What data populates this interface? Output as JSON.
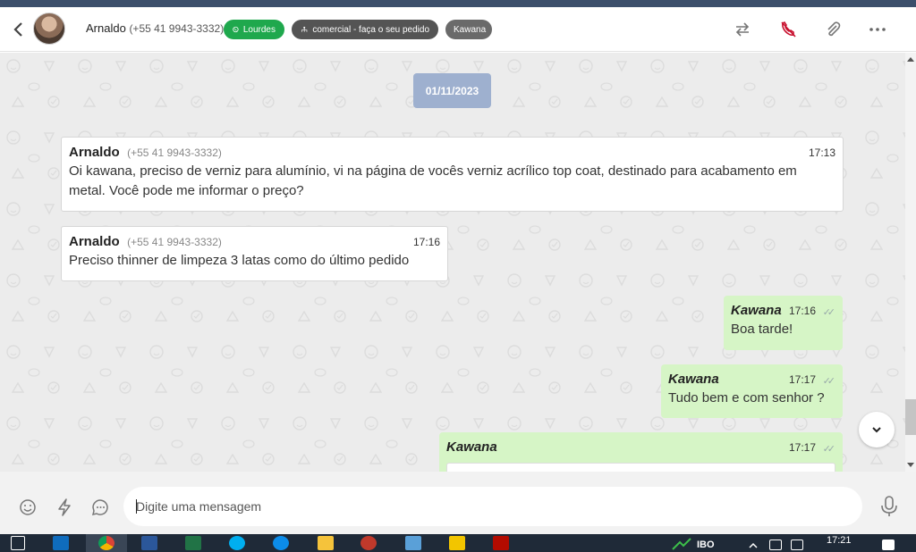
{
  "header": {
    "contact_name": "Arnaldo",
    "contact_phone": "(+55 41 9943-3332)",
    "tags": [
      {
        "label": "Lourdes",
        "color": "#1fa84d",
        "icon": "whatsapp-icon"
      },
      {
        "label": "comercial - faça o seu pedido",
        "color": "#545454",
        "icon": "org-chart-icon"
      },
      {
        "label": "Kawana",
        "color": "#6a6a6a"
      }
    ],
    "actions": [
      "transfer-icon",
      "end-call-icon",
      "attach-icon",
      "more-icon"
    ]
  },
  "chat": {
    "date_chip": "01/11/2023",
    "messages": [
      {
        "direction": "in",
        "sender": "Arnaldo",
        "phone": "(+55 41 9943-3332)",
        "time": "17:13",
        "text": "Oi kawana, preciso de verniz para alumínio, vi na página de vocês verniz acrílico top coat, destinado para acabamento em metal. Você pode me informar o preço?"
      },
      {
        "direction": "in",
        "sender": "Arnaldo",
        "phone": "(+55 41 9943-3332)",
        "time": "17:16",
        "text": "Preciso thinner de limpeza 3 latas como do último pedido"
      },
      {
        "direction": "out",
        "agent": "Kawana",
        "time": "17:16",
        "text": "Boa tarde!"
      },
      {
        "direction": "out",
        "agent": "Kawana",
        "time": "17:17",
        "text": "Tudo bem e com senhor ?"
      },
      {
        "direction": "out",
        "agent": "Kawana",
        "time": "17:17",
        "text": ""
      }
    ]
  },
  "composer": {
    "placeholder": "Digite uma mensagem",
    "icons": [
      "emoji-icon",
      "lightning-icon",
      "quick-reply-icon",
      "microphone-icon"
    ]
  },
  "taskbar": {
    "time": "17:21",
    "tray_label": "IBO"
  },
  "colors": {
    "incoming_bubble": "#ffffff",
    "outgoing_bubble": "#d6f5c6",
    "date_chip": "#9eb0cf",
    "chat_bg": "#ececec",
    "end_call": "#c8102e"
  }
}
